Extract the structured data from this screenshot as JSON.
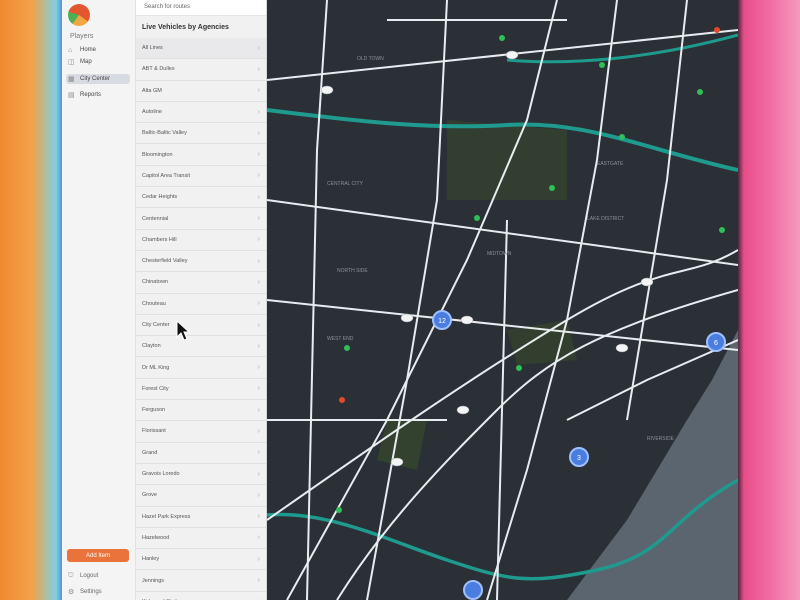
{
  "nav": {
    "section": "Players",
    "items": [
      {
        "label": "Home",
        "icon": "home-icon"
      },
      {
        "label": "Map",
        "icon": "map-icon"
      },
      {
        "label": "City Center",
        "icon": "building-icon",
        "active": true
      },
      {
        "label": "Reports",
        "icon": "report-icon"
      }
    ],
    "add_button": "Add Item",
    "footer": [
      {
        "label": "Logout",
        "icon": "logout-icon"
      },
      {
        "label": "Settings",
        "icon": "gear-icon"
      }
    ]
  },
  "panel": {
    "search_placeholder": "Search for routes",
    "title": "Live Vehicles by Agencies",
    "items": [
      "All Lines",
      "ABT & Dulles",
      "Alta GM",
      "Autoline",
      "Baltic-Baltic Valley",
      "Bloomington",
      "Capitol Area Transit",
      "Cedar Heights",
      "Centennial",
      "Chambers Hill",
      "Chesterfield Valley",
      "Chinatown",
      "Chouteau",
      "City Center",
      "Clayton",
      "Dr ML King",
      "Forest City",
      "Ferguson",
      "Florissant",
      "Grand",
      "Gravois Loredo",
      "Grove",
      "Hazel Park Express",
      "Hazelwood",
      "Hanley",
      "Jennings",
      "Kirkwood Station"
    ]
  },
  "map": {
    "road_color": "#e9ecef",
    "water_color": "#1e9a8e",
    "river_color": "#5b6570",
    "label_color": "#8b929c",
    "hub_color": "#4a7de0",
    "signal_green": "#2fbf56",
    "signal_red": "#e34a2a",
    "labels": [
      "CENTRAL CITY",
      "MIDTOWN",
      "OLD TOWN",
      "RIVERSIDE",
      "NORTH SIDE",
      "EASTGATE",
      "LAKE DISTRICT",
      "WEST END"
    ],
    "hubs": [
      "12",
      "3",
      "6"
    ]
  },
  "colors": {
    "accent": "#e9733a",
    "nav_bg": "#f4f4f4",
    "panel_bg": "#f1f1f2",
    "map_bg": "#2b2f36"
  }
}
